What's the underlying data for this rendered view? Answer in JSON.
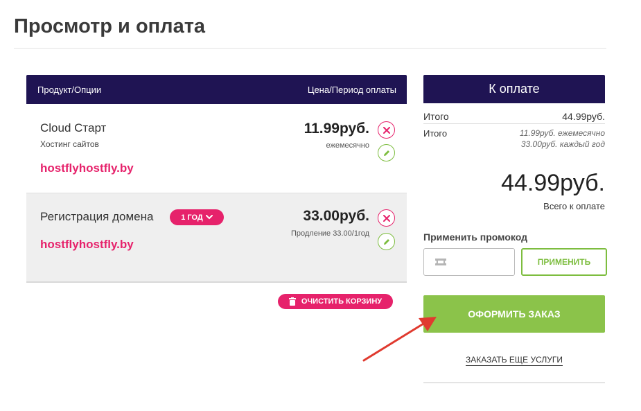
{
  "page": {
    "title": "Просмотр и оплата"
  },
  "cart": {
    "header": {
      "product_col": "Продукт/Опции",
      "price_col": "Цена/Период оплаты"
    },
    "items": [
      {
        "name": "Cloud Старт",
        "subtitle": "Хостинг сайтов",
        "domain": "hostflyhostfly.by",
        "price": "11.99руб.",
        "price_note": "ежемесячно"
      },
      {
        "name": "Регистрация домена",
        "period": "1 ГОД",
        "domain": "hostflyhostfly.by",
        "price": "33.00руб.",
        "price_note": "Продление 33.00/1год"
      }
    ],
    "clear_label": "ОЧИСТИТЬ КОРЗИНУ"
  },
  "summary": {
    "header": "К оплате",
    "subtotal": {
      "label": "Итого",
      "value": "44.99руб."
    },
    "details": {
      "label": "Итого",
      "line1": "11.99руб. ежемесячно",
      "line2": "33.00руб. каждый год"
    },
    "total": "44.99руб.",
    "total_label": "Всего к оплате",
    "promo_label": "Применить промокод",
    "promo_placeholder": "",
    "promo_button": "ПРИМЕНИТЬ",
    "checkout_button": "ОФОРМИТЬ ЗАКАЗ",
    "more_link": "ЗАКАЗАТЬ ЕЩЕ УСЛУГИ"
  },
  "colors": {
    "header_bg": "#1f1453",
    "accent_pink": "#e6226b",
    "accent_green": "#8bc34a",
    "annotation_arrow": "#e03a2f"
  },
  "icons": [
    "close-icon",
    "pencil-icon",
    "chevron-down-icon",
    "trash-icon",
    "ticket-icon",
    "arrow-annotation"
  ]
}
